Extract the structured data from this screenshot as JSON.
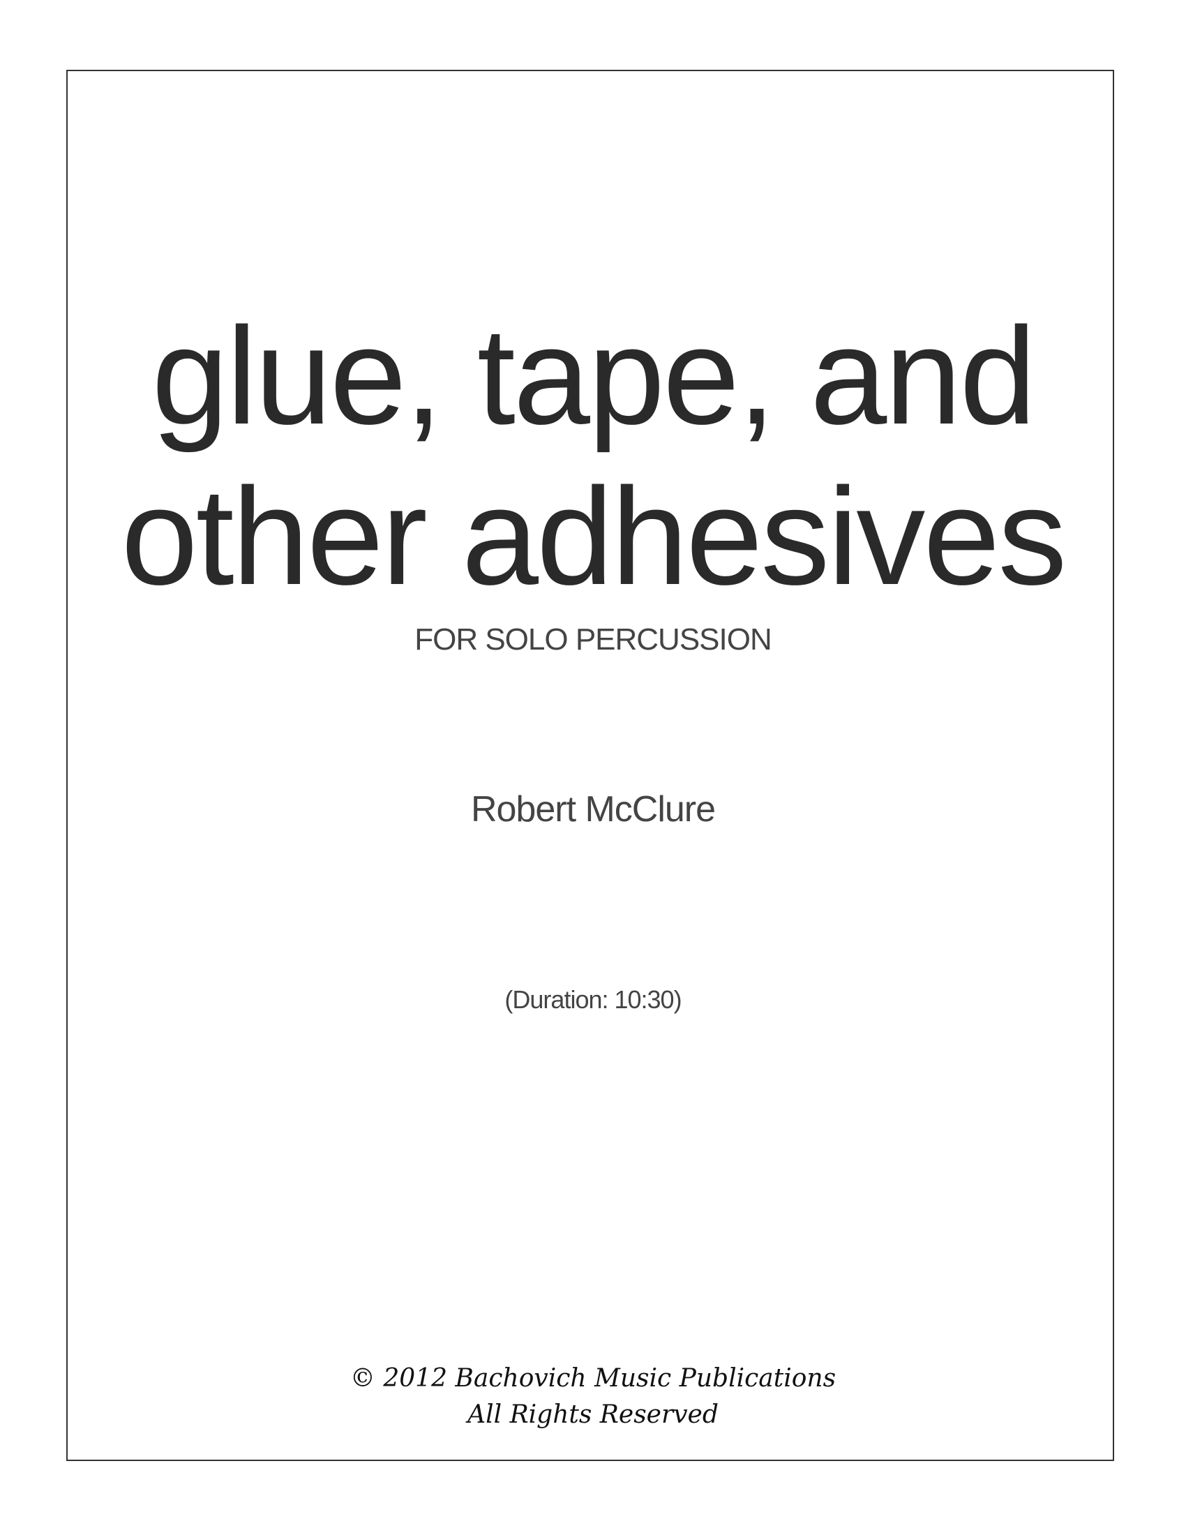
{
  "cover": {
    "title_line_1": "glue, tape, and",
    "title_line_2": "other adhesives",
    "subtitle": "FOR SOLO PERCUSSION",
    "composer": "Robert McClure",
    "duration": "(Duration: 10:30)",
    "copyright": "© 2012 Bachovich Music Publications",
    "rights": "All Rights Reserved"
  },
  "colors": {
    "frame": "#333333",
    "text": "#2a2a2a",
    "background": "#ffffff"
  }
}
